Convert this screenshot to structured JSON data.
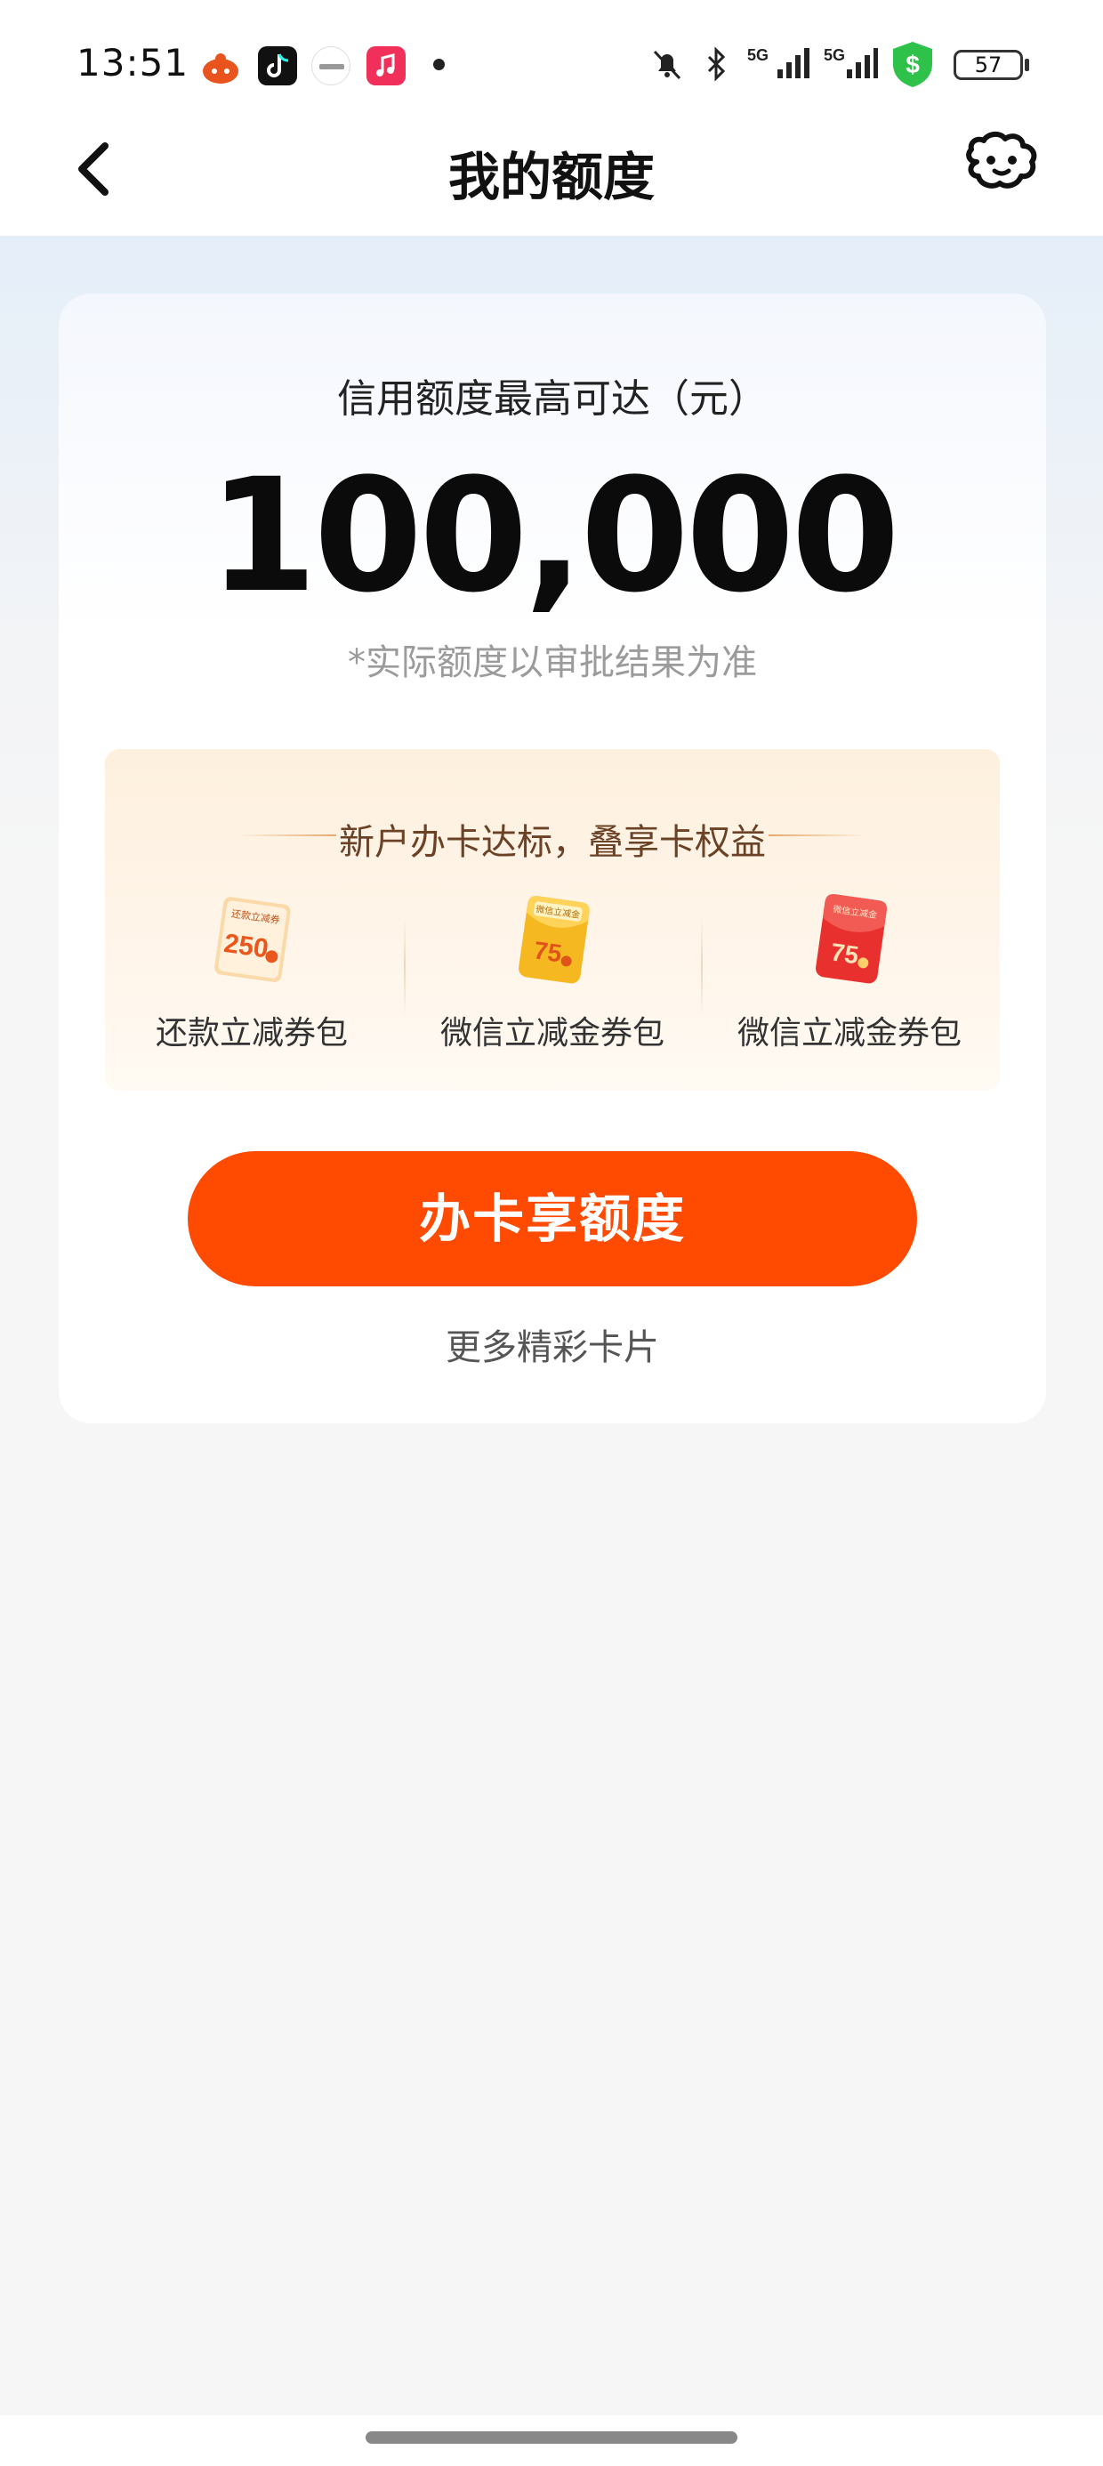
{
  "status_bar": {
    "time": "13:51",
    "battery": "57",
    "network_label": "5G"
  },
  "header": {
    "title": "我的额度"
  },
  "limit": {
    "label": "信用额度最高可达（元）",
    "amount": "100,000",
    "note": "*实际额度以审批结果为准"
  },
  "benefits": {
    "title": "新户办卡达标，叠享卡权益",
    "items": [
      {
        "label": "还款立减券包",
        "badge_text": "还款立减券",
        "value": "250"
      },
      {
        "label": "微信立减金券包",
        "badge_text": "微信立减金",
        "value": "75"
      },
      {
        "label": "微信立减金券包",
        "badge_text": "微信立减金",
        "value": "75"
      }
    ]
  },
  "actions": {
    "apply_label": "办卡享额度",
    "more_label": "更多精彩卡片"
  },
  "colors": {
    "accent": "#ff4a02",
    "card_bg": "#ffffff",
    "benefit_bg": "#fdf0de"
  }
}
